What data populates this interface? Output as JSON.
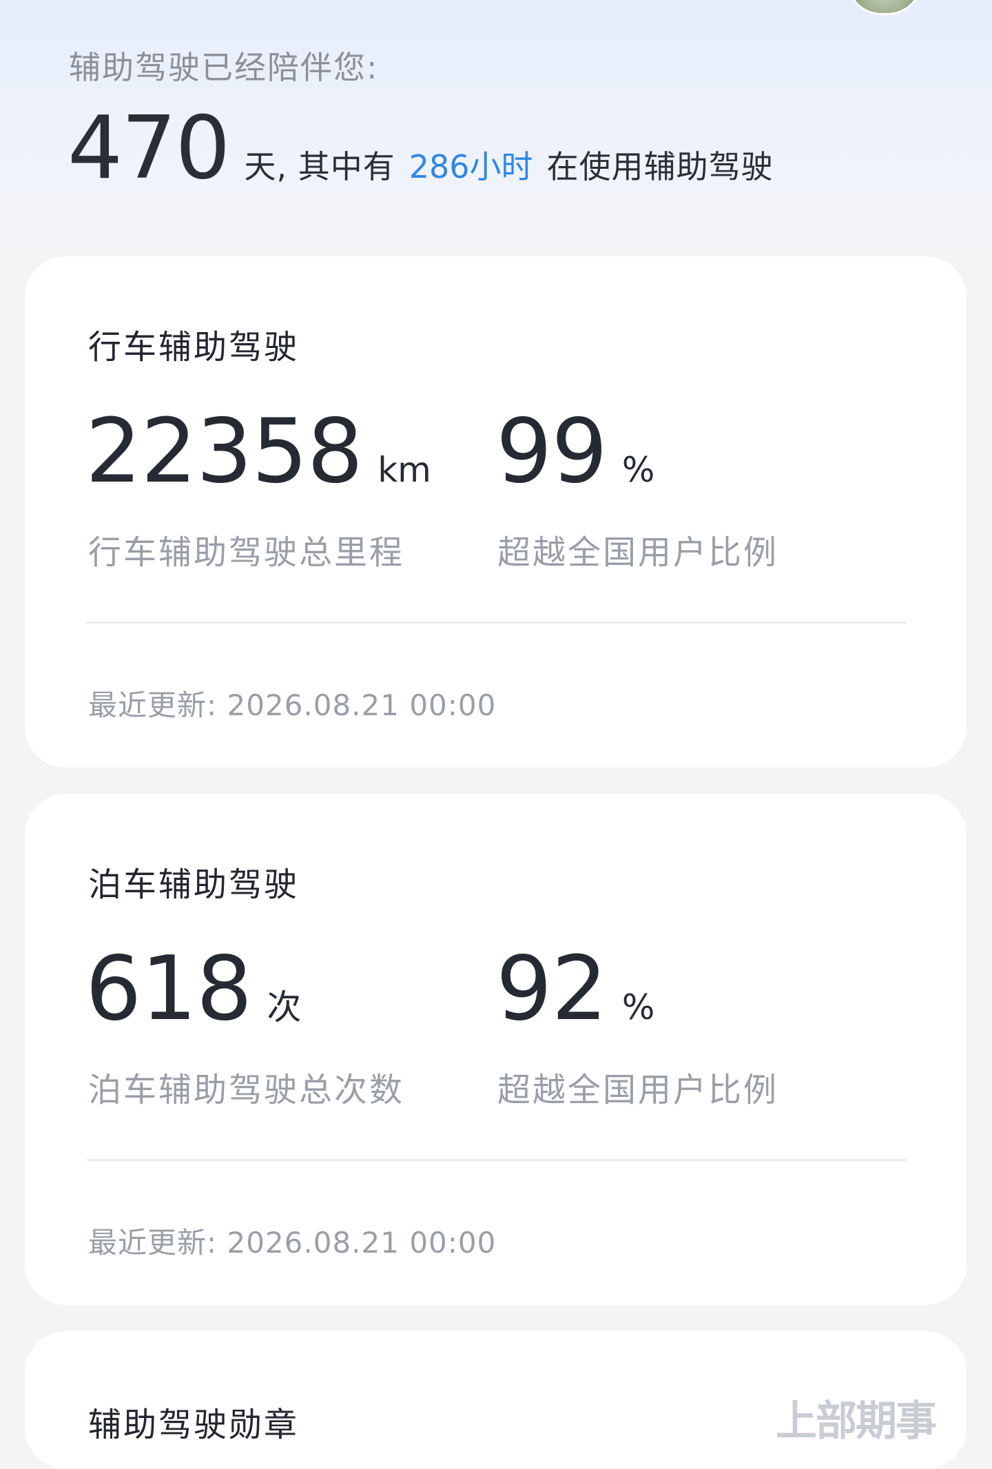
{
  "header": {
    "label": "辅助驾驶已经陪伴您:",
    "days": "470",
    "days_suffix": "天, 其中有",
    "hours_highlight": "286小时",
    "tail": "在使用辅助驾驶",
    "highlight_color": "#2f86e6"
  },
  "cards": [
    {
      "title": "行车辅助驾驶",
      "left_value": "22358",
      "left_unit": "km",
      "left_desc": "行车辅助驾驶总里程",
      "right_value": "99",
      "right_unit": "%",
      "right_desc": "超越全国用户比例",
      "updated": "最近更新: 2026.08.21 00:00"
    },
    {
      "title": "泊车辅助驾驶",
      "left_value": "618",
      "left_unit": "次",
      "left_desc": "泊车辅助驾驶总次数",
      "right_value": "92",
      "right_unit": "%",
      "right_desc": "超越全国用户比例",
      "updated": "最近更新: 2026.08.21 00:00"
    }
  ],
  "badges": {
    "title": "辅助驾驶勋章",
    "watermark": "上部期事"
  }
}
